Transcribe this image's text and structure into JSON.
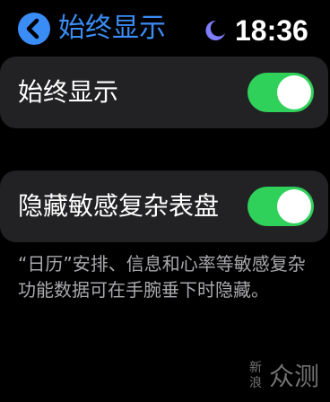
{
  "header": {
    "title": "始终显示",
    "time": "18:36"
  },
  "settings": [
    {
      "label": "始终显示",
      "enabled": true
    },
    {
      "label": "隐藏敏感复杂表盘",
      "enabled": true
    }
  ],
  "footnote": "“日历”安排、信息和心率等敏感复杂功能数据可在手腕垂下时隐藏。",
  "watermark": {
    "line1": "新浪",
    "line2": "众测"
  },
  "colors": {
    "accent": "#3a8df6",
    "toggle_on": "#2fd15a",
    "moon": "#7f7dfb"
  }
}
